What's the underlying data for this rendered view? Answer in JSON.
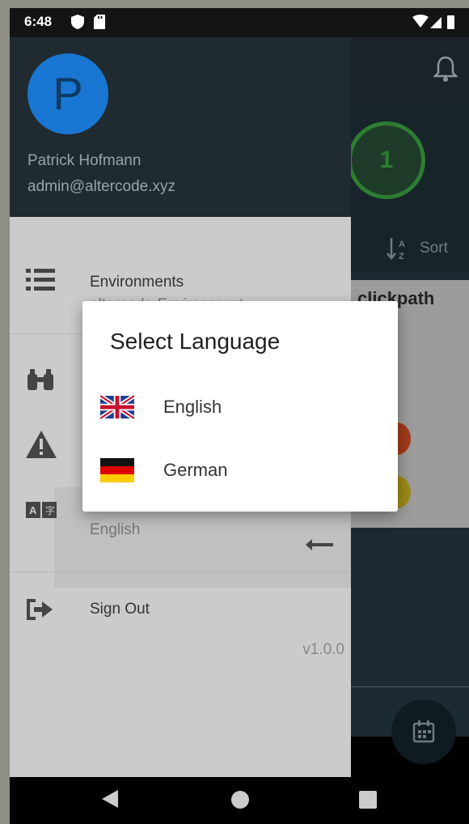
{
  "status_bar": {
    "time": "6:48"
  },
  "app": {
    "count_value": "1",
    "sort_label": "Sort",
    "card_title": "clickpath"
  },
  "drawer": {
    "avatar_initial": "P",
    "user_name": "Patrick Hofmann",
    "user_email": "admin@altercode.xyz",
    "environments_title": "Environments",
    "environments_subtitle": "altercode Environment",
    "language_value": "English",
    "sign_out": "Sign Out",
    "version": "v1.0.0"
  },
  "dialog": {
    "title": "Select Language",
    "options": [
      {
        "label": "English",
        "flag": "uk-flag-icon"
      },
      {
        "label": "German",
        "flag": "germany-flag-icon"
      }
    ]
  },
  "colors": {
    "avatar": "#1976d2",
    "count_ring": "#2e7d32",
    "scrim": "rgba(0,0,0,0.4)"
  }
}
